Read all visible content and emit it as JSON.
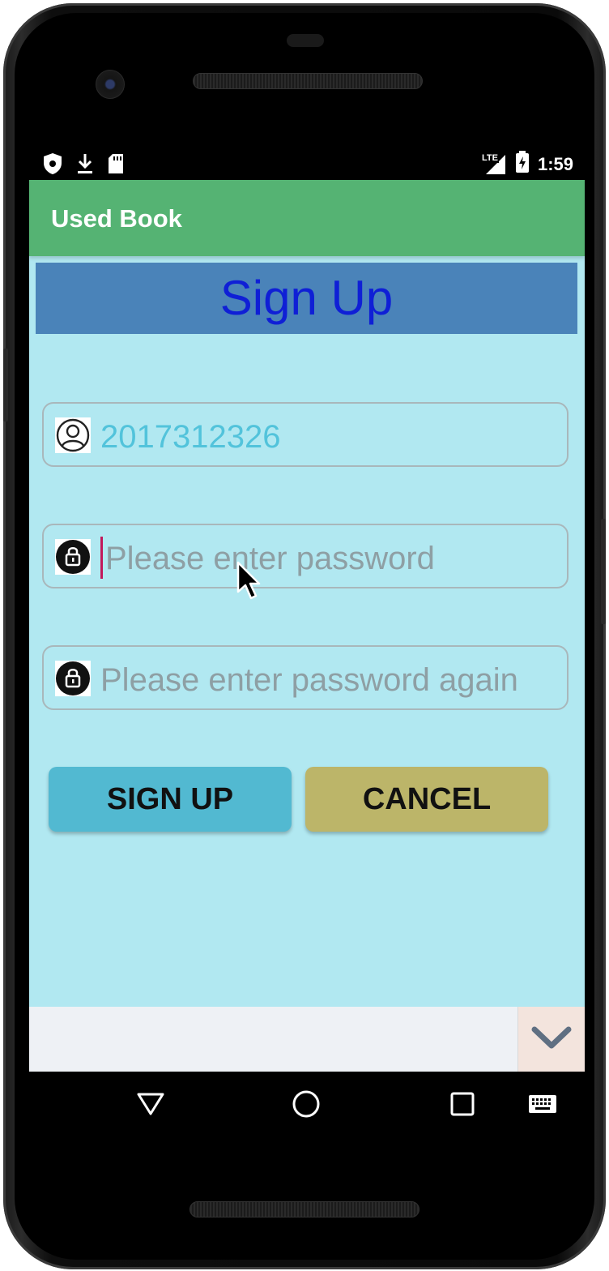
{
  "status_bar": {
    "time": "1:59",
    "network": "LTE",
    "left_icons": [
      "shield-icon",
      "download-icon",
      "sd-card-icon"
    ],
    "right_icons": [
      "signal-icon",
      "battery-charging-icon"
    ]
  },
  "app_bar": {
    "title": "Used Book",
    "color": "#55b373"
  },
  "page": {
    "heading": "Sign Up",
    "heading_color": "#0f1fd6",
    "banner_color": "#4a83b9",
    "background": "#b1e8f1"
  },
  "form": {
    "username": {
      "value": "2017312326",
      "icon": "user-circle-icon"
    },
    "password": {
      "placeholder": "Please enter password",
      "icon": "lock-icon",
      "focused": true
    },
    "password_again": {
      "placeholder": "Please enter password again",
      "icon": "lock-icon"
    }
  },
  "buttons": {
    "sign_up": "SIGN UP",
    "cancel": "CANCEL",
    "sign_up_color": "#52b9d1",
    "cancel_color": "#bcb569"
  },
  "bottom_bar": {
    "icon": "chevron-down-icon"
  },
  "navigation_bar": {
    "items": [
      "back-icon",
      "home-icon",
      "recents-icon",
      "keyboard-icon"
    ]
  }
}
